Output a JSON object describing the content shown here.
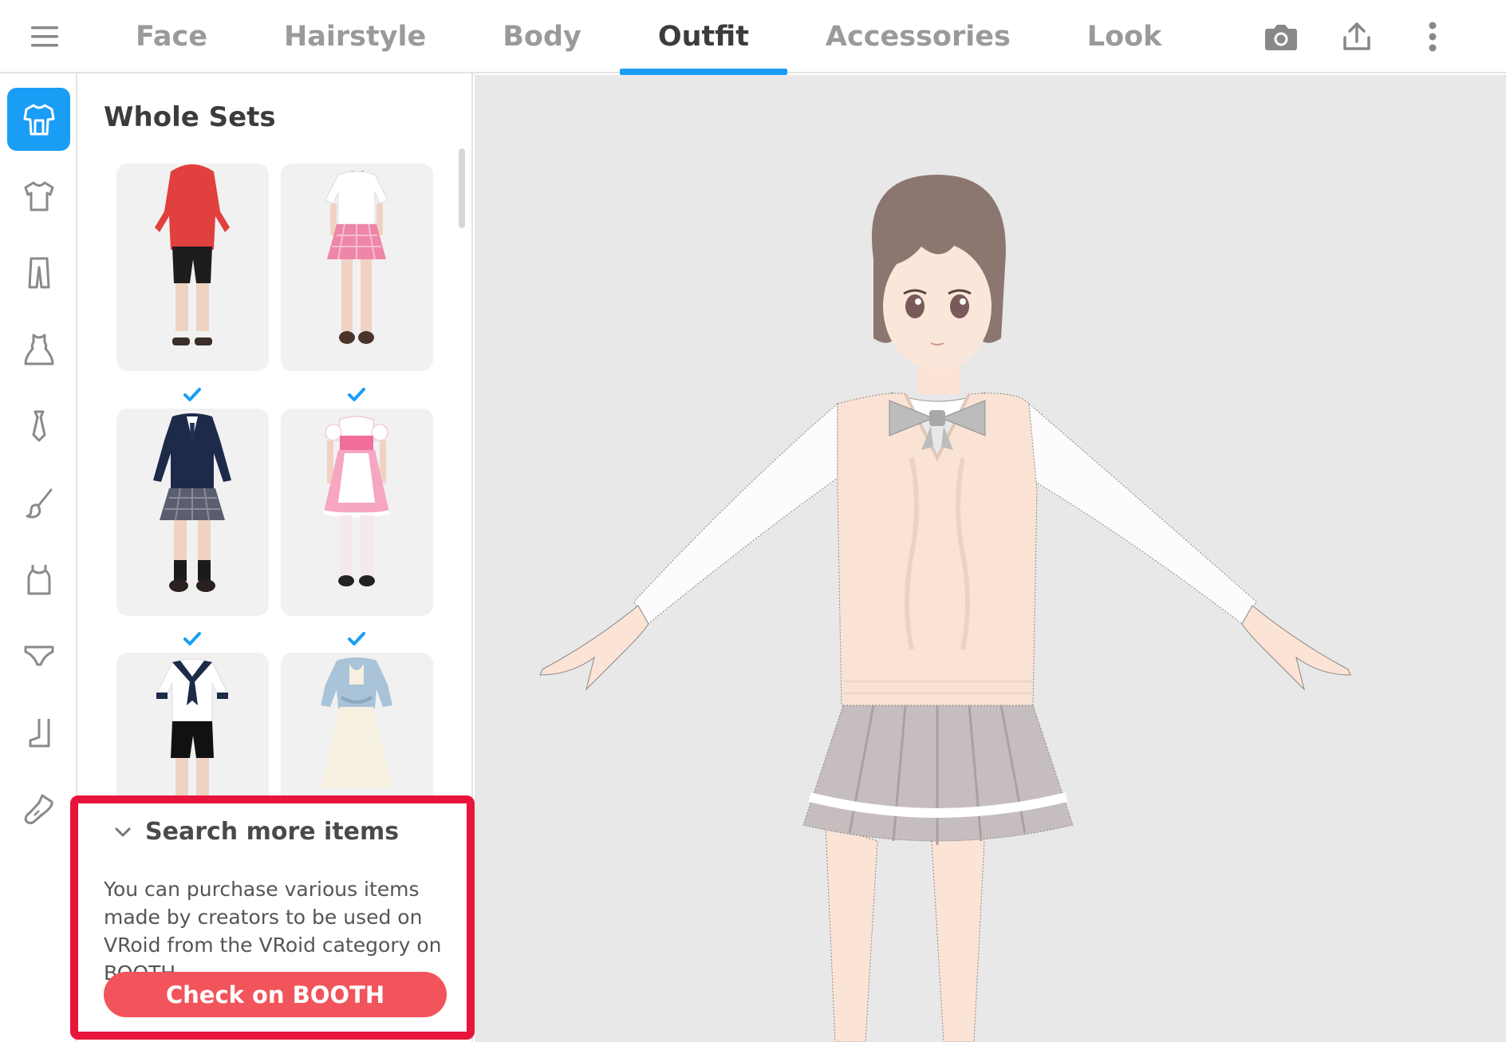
{
  "tabs": [
    {
      "label": "Face",
      "active": false
    },
    {
      "label": "Hairstyle",
      "active": false
    },
    {
      "label": "Body",
      "active": false
    },
    {
      "label": "Outfit",
      "active": true
    },
    {
      "label": "Accessories",
      "active": false
    },
    {
      "label": "Look",
      "active": false
    }
  ],
  "toolbar_icons": [
    "menu-icon",
    "camera-icon",
    "share-icon",
    "more-vertical-icon"
  ],
  "sidebar": {
    "items": [
      {
        "icon": "whole-set-icon",
        "active": true
      },
      {
        "icon": "tshirt-icon",
        "active": false
      },
      {
        "icon": "pants-icon",
        "active": false
      },
      {
        "icon": "dress-icon",
        "active": false
      },
      {
        "icon": "tie-icon",
        "active": false
      },
      {
        "icon": "brush-icon",
        "active": false
      },
      {
        "icon": "tank-top-icon",
        "active": false
      },
      {
        "icon": "underwear-icon",
        "active": false
      },
      {
        "icon": "socks-icon",
        "active": false
      },
      {
        "icon": "shoes-icon",
        "active": false
      }
    ]
  },
  "panel": {
    "title": "Whole Sets",
    "items": [
      {
        "name": "red hoodie set",
        "checked": false
      },
      {
        "name": "pink plaid skirt set",
        "checked": false
      },
      {
        "name": "navy blazer uniform",
        "checked": true
      },
      {
        "name": "pink maid outfit",
        "checked": true
      },
      {
        "name": "sailor uniform",
        "checked": true
      },
      {
        "name": "denim shirt dress",
        "checked": true
      }
    ]
  },
  "search": {
    "title": "Search more items",
    "description": "You can purchase various items made by creators to be used on VRoid from the VRoid category on BOOTH.",
    "button": "Check on BOOTH"
  },
  "colors": {
    "accent": "#1a9df5",
    "highlight_border": "#e8143c",
    "booth_button": "#f2545b",
    "viewport_bg": "#e9e8e8"
  }
}
